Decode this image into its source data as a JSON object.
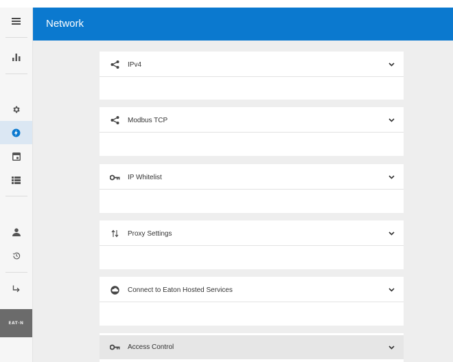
{
  "header": {
    "title": "Network"
  },
  "rail": {
    "items": [
      {
        "icon": "menu-icon"
      },
      {
        "icon": "bar-chart-icon"
      },
      {
        "icon": "gear-icon"
      },
      {
        "icon": "lightning-icon",
        "active": true
      },
      {
        "icon": "calendar-icon"
      },
      {
        "icon": "list-icon"
      },
      {
        "icon": "user-icon"
      },
      {
        "icon": "history-icon"
      },
      {
        "icon": "logout-icon"
      }
    ],
    "logo_text": "EAT·N"
  },
  "sections": [
    {
      "label": "IPv4",
      "icon": "share-icon"
    },
    {
      "label": "Modbus TCP",
      "icon": "share-icon"
    },
    {
      "label": "IP Whitelist",
      "icon": "key-icon"
    },
    {
      "label": "Proxy Settings",
      "icon": "arrows-updown-icon"
    },
    {
      "label": "Connect to Eaton Hosted Services",
      "icon": "cloud-icon"
    },
    {
      "label": "Access Control",
      "icon": "key-icon",
      "highlighted": true
    }
  ],
  "colors": {
    "accent": "#0b79cf",
    "rail_bg": "#f6f6f6",
    "content_bg": "#eeeeee",
    "active_bg": "#dbe7f3"
  }
}
